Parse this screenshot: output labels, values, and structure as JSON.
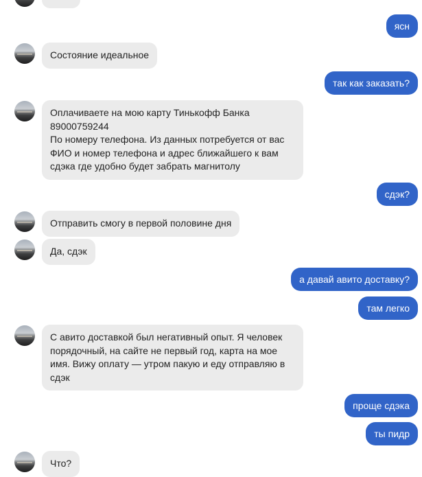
{
  "messages": {
    "m0": "",
    "m1": "ясн",
    "m2": "Состояние идеальное",
    "m3": "так как заказать?",
    "m4": "Оплачиваете на мою карту Тинькофф Банка\n89000759244\nПо номеру телефона. Из данных потребуется от вас\nФИО и номер телефона и адрес ближайшего к вам\nсдэка где удобно будет забрать магнитолу",
    "m5": "сдэк?",
    "m6": "Отправить смогу в первой половине дня",
    "m7": "Да, сдэк",
    "m8": "а давай авито доставку?",
    "m9": "там легко",
    "m10": "С авито доставкой был негативный опыт. Я человек\nпорядочный, на сайте не первый год, карта на мое\nимя. Вижу оплату — утром пакую и еду отправляю в\nсдэк",
    "m11": "проще сдэка",
    "m12": "ты пидр",
    "m13": "Что?"
  },
  "colors": {
    "incoming_bubble": "#ebebeb",
    "outgoing_bubble": "#3164c8",
    "outgoing_text": "#ffffff"
  },
  "icons": {
    "avatar": "contact-avatar-icon"
  }
}
